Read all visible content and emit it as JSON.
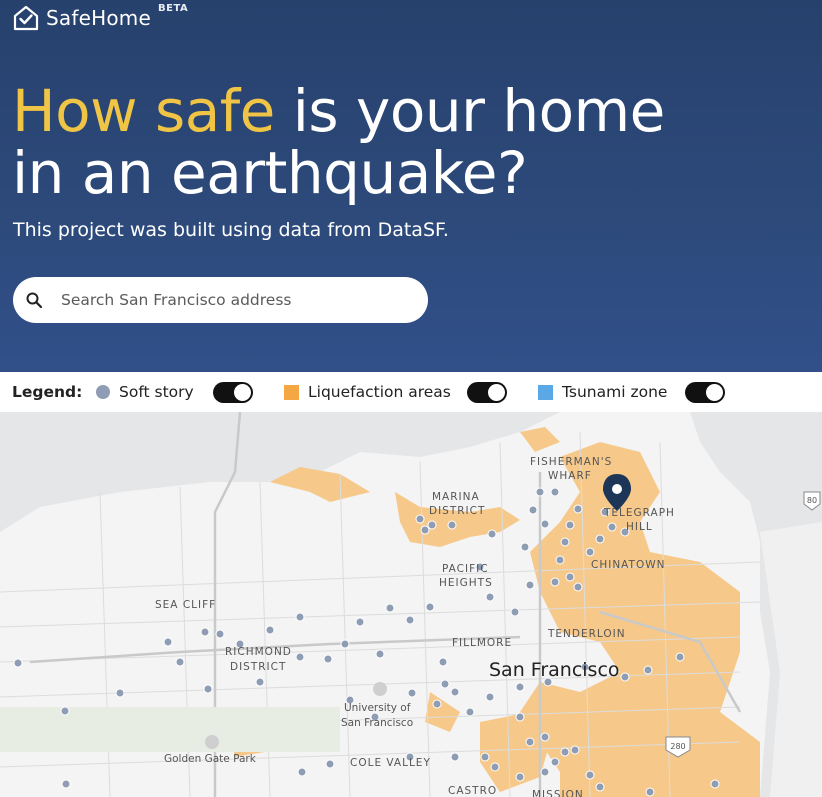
{
  "app": {
    "name": "SafeHome",
    "badge": "BETA"
  },
  "hero": {
    "headline_accent": "How safe",
    "headline_rest_1": " is your home",
    "headline_line2": "in an earthquake?",
    "subtitle": "This project was built using data from DataSF."
  },
  "search": {
    "placeholder": "Search San Francisco address",
    "value": ""
  },
  "legend": {
    "title": "Legend:",
    "items": [
      {
        "label": "Soft story",
        "color": "#8e9db4",
        "shape": "dot",
        "toggled_on": true
      },
      {
        "label": "Liquefaction areas",
        "color": "#f4a742",
        "shape": "square",
        "toggled_on": true
      },
      {
        "label": "Tsunami zone",
        "color": "#5aa9e6",
        "shape": "square",
        "toggled_on": true
      }
    ]
  },
  "map": {
    "city_label": "San Francisco",
    "neighborhoods": [
      "FISHERMAN'S",
      "WHARF",
      "MARINA",
      "DISTRICT",
      "TELEGRAPH",
      "HILL",
      "PACIFIC",
      "HEIGHTS",
      "CHINATOWN",
      "SEA CLIFF",
      "RICHMOND",
      "DISTRICT",
      "FILLMORE",
      "TENDERLOIN",
      "COLE VALLEY",
      "CASTRO",
      "MISSION"
    ],
    "places": [
      "University of",
      "San Francisco",
      "Golden Gate Park"
    ],
    "highway_shields": [
      "80",
      "280"
    ],
    "colors": {
      "land": "#f4f4f4",
      "water": "#d7dee6",
      "liquefaction": "#f6c98a",
      "soft_story": "#8e9db4",
      "pin": "#1d3557"
    }
  }
}
